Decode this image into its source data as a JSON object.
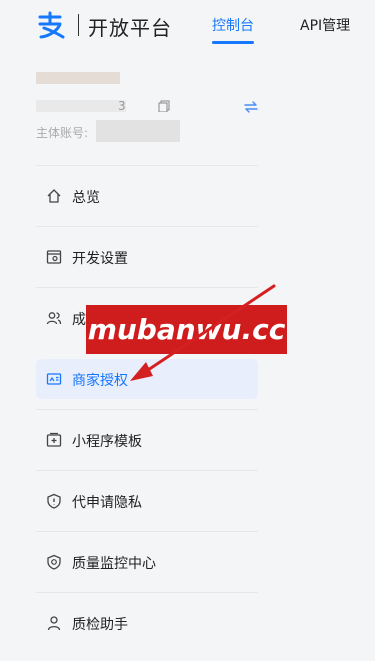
{
  "header": {
    "brand": "开放平台",
    "tabs": [
      {
        "label": "控制台",
        "active": true
      },
      {
        "label": "API管理",
        "active": false
      }
    ]
  },
  "account": {
    "id_suffix": "3",
    "label": "主体账号:"
  },
  "menu": [
    {
      "label": "总览",
      "icon": "home-icon"
    },
    {
      "label": "开发设置",
      "icon": "settings-panel-icon"
    },
    {
      "label": "成员管理",
      "icon": "members-icon"
    },
    {
      "label": "商家授权",
      "icon": "id-card-icon",
      "active": true
    },
    {
      "label": "小程序模板",
      "icon": "template-icon"
    },
    {
      "label": "代申请隐私",
      "icon": "shield-icon"
    },
    {
      "label": "质量监控中心",
      "icon": "quality-icon"
    },
    {
      "label": "质检助手",
      "icon": "user-icon"
    }
  ],
  "watermark": {
    "text": "mubanwu.cc"
  },
  "colors": {
    "accent": "#1677ff",
    "active_bg": "#e8eefb",
    "watermark_bg": "#cf1d1d",
    "arrow": "#d42020"
  }
}
